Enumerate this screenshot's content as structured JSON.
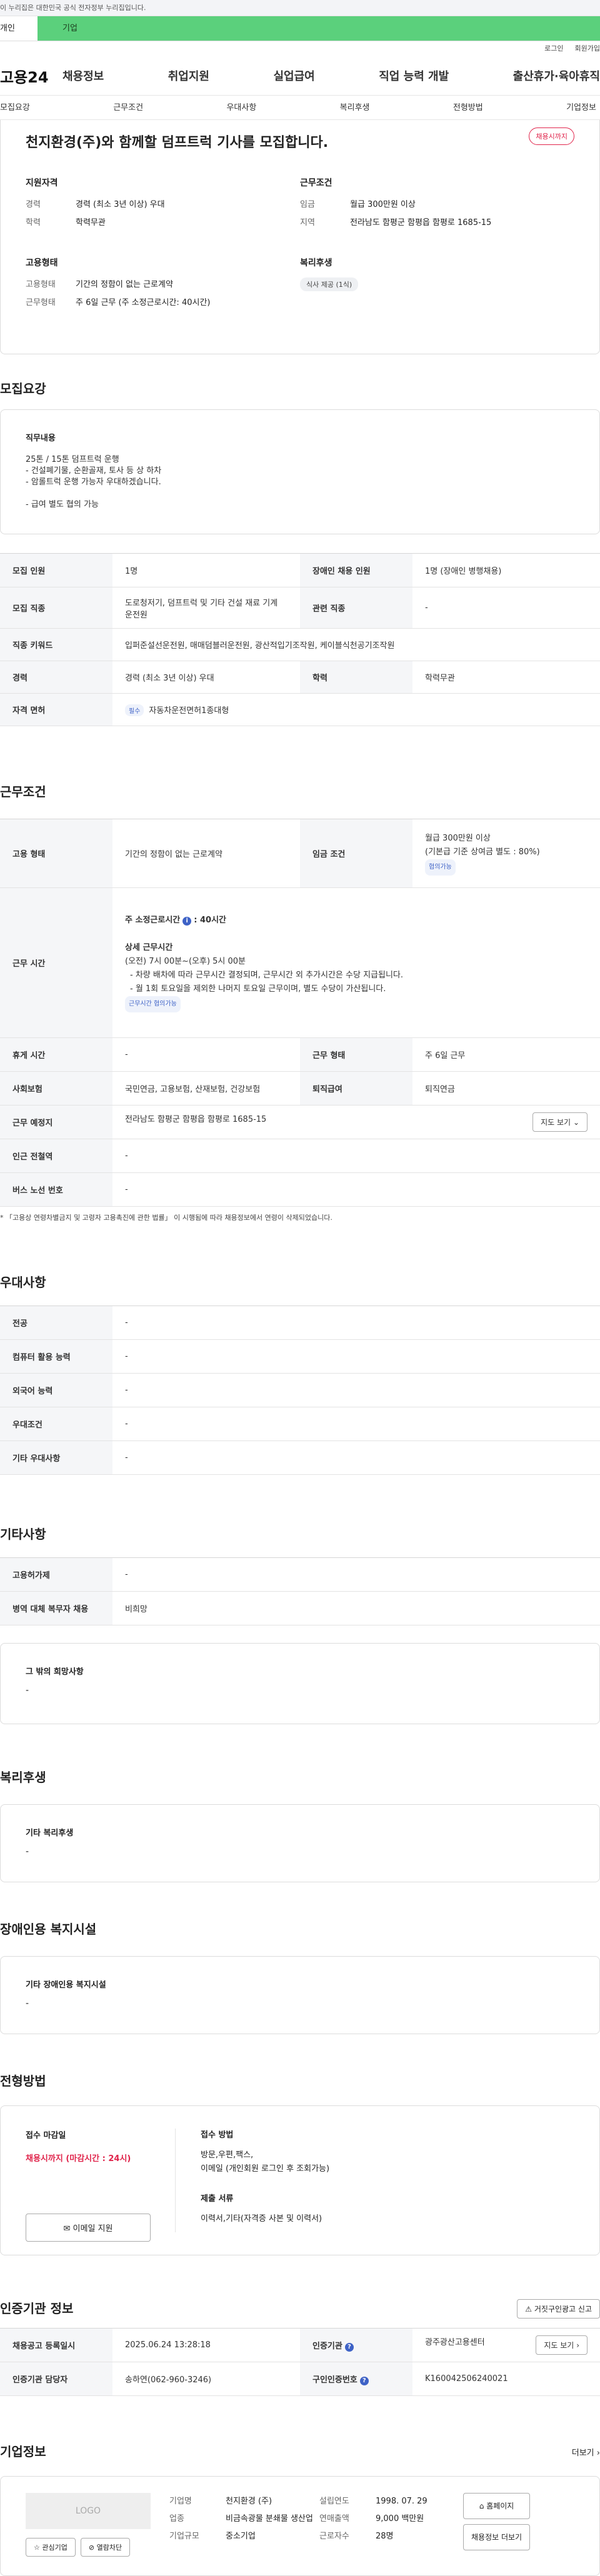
{
  "gov_bar": "이 누리집은 대한민국 공식 전자정부 누리집입니다.",
  "user_tabs": {
    "personal": "개인",
    "company": "기업"
  },
  "util": {
    "login": "로그인",
    "signup": "회원가입"
  },
  "logo": "고용24",
  "gnb": [
    "채용정보",
    "취업지원",
    "실업급여",
    "직업 능력 개발",
    "출산휴가·육아휴직"
  ],
  "section_tabs": [
    "모집요강",
    "근무조건",
    "우대사항",
    "복리후생",
    "전형방법",
    "기업정보"
  ],
  "top": {
    "title": "천지환경(주)와 함께할 덤프트럭 기사를 모집합니다.",
    "badge": "채용시까지",
    "qual": {
      "title": "지원자격",
      "career_k": "경력",
      "career_v": "경력 (최소 3년 이상) 우대",
      "edu_k": "학력",
      "edu_v": "학력무관"
    },
    "cond": {
      "title": "근무조건",
      "wage_k": "임금",
      "wage_v": "월급 300만원 이상",
      "loc_k": "지역",
      "loc_v": "전라남도 함평군 함평읍 함평로 1685-15"
    },
    "emp": {
      "title": "고용형태",
      "type_k": "고용형태",
      "type_v": "기간의 정함이 없는 근로계약",
      "work_k": "근무형태",
      "work_v": "주 6일 근무 (주 소정근로시간: 40시간)"
    },
    "welfare": {
      "title": "복리후생",
      "pill": "식사 제공 (1식)"
    }
  },
  "recruit": {
    "heading": "모집요강",
    "duty_label": "직무내용",
    "duty_text": "25톤 / 15톤 덤프트럭 운행\n- 건설폐기물, 순환골재, 토사 등 상 하차\n- 암롤트럭 운행 가능자 우대하겠습니다.\n\n- 급여 별도 협의 가능",
    "rows": {
      "count_k": "모집 인원",
      "count_v": "1명",
      "disabled_k": "장애인 채용 인원",
      "disabled_v": "1명 (장애인 병행채용)",
      "job_k": "모집 직종",
      "job_v": "도로청저기, 덤프트럭 및 기타 건설 재료 기계 운전원",
      "rel_k": "관련 직종",
      "rel_v": "-",
      "kw_k": "직종 키워드",
      "kw_v": "입퍼준설선운전원, 매매덤블러운전원, 광산적입기조작원, 케이블식천공기조작원",
      "career_k": "경력",
      "career_v": "경력 (최소 3년 이상) 우대",
      "edu_k": "학력",
      "edu_v": "학력무관",
      "lic_k": "자격 면허",
      "lic_tag": "필수",
      "lic_v": "자동차운전면허1종대형"
    }
  },
  "work": {
    "heading": "근무조건",
    "emp_k": "고용 형태",
    "emp_v": "기간의 정함이 없는 근로계약",
    "wage_k": "임금 조건",
    "wage_v1": "월급 300만원 이상",
    "wage_v2": "(기본급 기준 상여금 별도 : 80%)",
    "wage_tag": "협의가능",
    "time_k": "근무 시간",
    "time_main": "주 소정근로시간",
    "time_hours": ": 40시간",
    "time_detail_title": "상세 근무시간",
    "time_detail": "(오전) 7시 00분~(오후) 5시 00분",
    "time_b1": "- 차량 배차에 따라 근무시간 결정되며, 근무시간 외 추가시간은 수당 지급됩니다.",
    "time_b2": "- 월 1회 토요일을 제외한 나머지 토요일 근무이며, 별도 수당이 가산됩니다.",
    "time_tag": "근무시간 협의가능",
    "rest_k": "휴게 시간",
    "rest_v": "-",
    "form_k": "근무 형태",
    "form_v": "주 6일 근무",
    "ins_k": "사회보험",
    "ins_v": "국민연금, 고용보험, 산재보험, 건강보험",
    "ret_k": "퇴직급여",
    "ret_v": "퇴직연금",
    "place_k": "근무 예정지",
    "place_v": "전라남도 함평군 함평읍 함평로 1685-15",
    "map_btn": "지도 보기",
    "sub_k": "인근 전철역",
    "sub_v": "-",
    "bus_k": "버스 노선 번호",
    "bus_v": "-",
    "note": "* 「고용상 연령차별금지 및 고령자 고용촉진에 관한 법률」 이 시행됨에 따라 채용정보에서 연령이 삭제되었습니다."
  },
  "pref": {
    "heading": "우대사항",
    "rows": [
      [
        "전공",
        "-"
      ],
      [
        "컴퓨터 활용 능력",
        "-"
      ],
      [
        "외국어 능력",
        "-"
      ],
      [
        "우대조건",
        "-"
      ],
      [
        "기타 우대사항",
        "-"
      ]
    ]
  },
  "etc": {
    "heading": "기타사항",
    "rows": [
      [
        "고용허가제",
        "-"
      ],
      [
        "병역 대체 복무자 채용",
        "비희망"
      ]
    ],
    "hope_label": "그 밖의 희망사항",
    "hope_v": "-"
  },
  "benefit": {
    "heading": "복리후생",
    "label": "기타 복리후생",
    "v": "-"
  },
  "facility": {
    "heading": "장애인용 복지시설",
    "label": "기타 장애인용 복지시설",
    "v": "-"
  },
  "screen": {
    "heading": "전형방법",
    "deadline_label": "접수 마감일",
    "deadline_v": "채용시까지 (마감시간 : 24시)",
    "email_btn": "이메일 지원",
    "method_label": "접수 방법",
    "method_v1": "방문,우편,팩스,",
    "method_v2": "이메일 (개인회원 로그인 후 조회가능)",
    "docs_label": "제출 서류",
    "docs_v": "이력서,기타(자격증 사본 및 이력서)"
  },
  "cert": {
    "heading": "인증기관 정보",
    "fake_btn": "거짓구인광고 신고",
    "reg_k": "채용공고 등록일시",
    "reg_v": "2025.06.24 13:28:18",
    "org_k": "인증기관",
    "org_v": "광주광산고용센터",
    "map_btn": "지도 보기",
    "mgr_k": "인증기관 담당자",
    "mgr_v": "송하연(062-960-3246)",
    "no_k": "구인인증번호",
    "no_v": "K160042506240021"
  },
  "company": {
    "heading": "기업정보",
    "more": "더보기",
    "logo": "LOGO",
    "fav": "관심기업",
    "block": "열람차단",
    "name_k": "기업명",
    "name_v": "천지환경 (주)",
    "ind_k": "업종",
    "ind_v": "비금속광물 분쇄물 생산업",
    "size_k": "기업규모",
    "size_v": "중소기업",
    "est_k": "설립연도",
    "est_v": "1998. 07. 29",
    "sales_k": "연매출액",
    "sales_v": "9,000 백만원",
    "emp_k": "근로자수",
    "emp_v": "28명",
    "home_btn": "홈페이지",
    "jobs_btn": "채용정보 더보기"
  }
}
